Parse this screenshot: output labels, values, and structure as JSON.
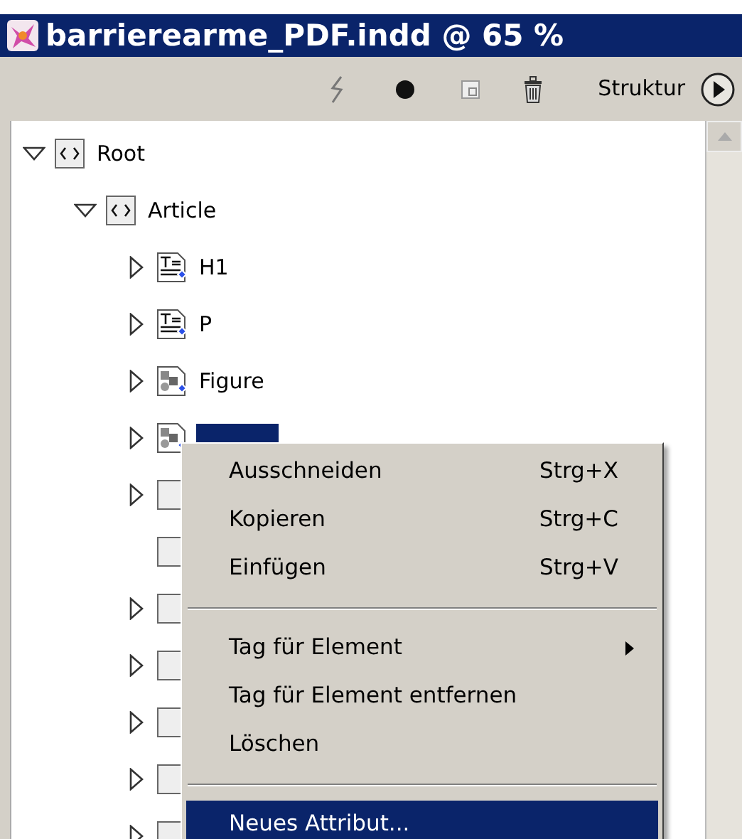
{
  "window": {
    "title": "barrierearme_PDF.indd @ 65 %"
  },
  "toolbar": {
    "panel_label": "Struktur"
  },
  "tree": [
    {
      "kind": "element",
      "label": "Root",
      "expanded": true,
      "selected": false,
      "children": [
        {
          "kind": "element",
          "label": "Article",
          "expanded": true,
          "selected": false,
          "children": [
            {
              "kind": "text",
              "label": "H1",
              "expanded": false,
              "selected": false
            },
            {
              "kind": "text",
              "label": "P",
              "expanded": false,
              "selected": false
            },
            {
              "kind": "graphic",
              "label": "Figure",
              "expanded": false,
              "selected": false
            },
            {
              "kind": "graphic",
              "expanded": false,
              "selected": true
            },
            {
              "kind": "tag",
              "expanded": false
            },
            {
              "kind": "tag"
            },
            {
              "kind": "tag",
              "expanded": false
            },
            {
              "kind": "tag",
              "expanded": false
            },
            {
              "kind": "tag",
              "expanded": false
            },
            {
              "kind": "tag",
              "expanded": false
            },
            {
              "kind": "tag",
              "expanded": false
            }
          ]
        }
      ]
    }
  ],
  "context_menu": [
    {
      "kind": "item",
      "label": "Ausschneiden",
      "shortcut": "Strg+X",
      "submenu": false,
      "selected": false
    },
    {
      "kind": "item",
      "label": "Kopieren",
      "shortcut": "Strg+C",
      "submenu": false,
      "selected": false
    },
    {
      "kind": "item",
      "label": "Einfügen",
      "shortcut": "Strg+V",
      "submenu": false,
      "selected": false
    },
    {
      "kind": "separator"
    },
    {
      "kind": "item",
      "label": "Tag für Element",
      "submenu": true,
      "selected": false
    },
    {
      "kind": "item",
      "label": "Tag für Element entfernen",
      "submenu": false,
      "selected": false
    },
    {
      "kind": "item",
      "label": "Löschen",
      "submenu": false,
      "selected": false
    },
    {
      "kind": "separator"
    },
    {
      "kind": "item",
      "label": "Neues Attribut...",
      "submenu": false,
      "selected": true
    }
  ]
}
